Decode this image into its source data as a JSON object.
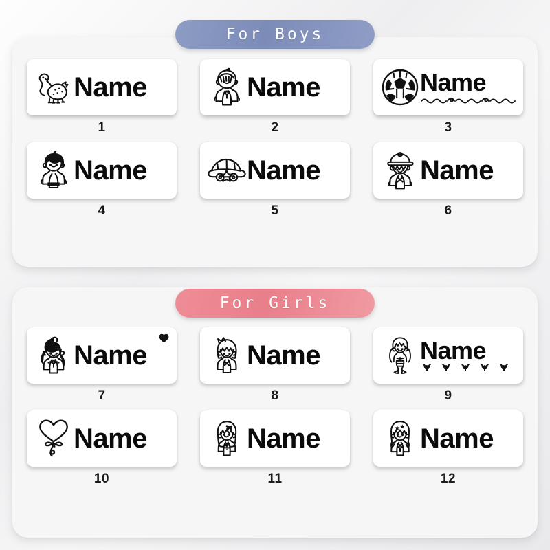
{
  "background": {
    "page_bg": "#f2f2f3",
    "panel_bg": "#f6f6f7"
  },
  "sections": [
    {
      "id": "boys",
      "banner_label": "For Boys",
      "banner_color": "#7c8cb8",
      "labels": [
        {
          "number": "1",
          "name": "Name",
          "icon": "dinosaur-icon",
          "decoration": "none"
        },
        {
          "number": "2",
          "name": "Name",
          "icon": "boy-outline-icon",
          "decoration": "none"
        },
        {
          "number": "3",
          "name": "Name",
          "icon": "soccer-ball-icon",
          "decoration": "wavy-line"
        },
        {
          "number": "4",
          "name": "Name",
          "icon": "boy-dark-hair-icon",
          "decoration": "none"
        },
        {
          "number": "5",
          "name": "Name",
          "icon": "car-icon",
          "decoration": "none"
        },
        {
          "number": "6",
          "name": "Name",
          "icon": "boy-cap-icon",
          "decoration": "none"
        }
      ]
    },
    {
      "id": "girls",
      "banner_label": "For Girls",
      "banner_color": "#e87f8b",
      "labels": [
        {
          "number": "7",
          "name": "Name",
          "icon": "girl-pigtails-icon",
          "decoration": "corner-heart"
        },
        {
          "number": "8",
          "name": "Name",
          "icon": "princess-crown-icon",
          "decoration": "none"
        },
        {
          "number": "9",
          "name": "Name",
          "icon": "mermaid-icon",
          "decoration": "seaweed-row"
        },
        {
          "number": "10",
          "name": "Name",
          "icon": "heart-balloon-icon",
          "decoration": "none"
        },
        {
          "number": "11",
          "name": "Name",
          "icon": "girl-longhair-bow-icon",
          "decoration": "none"
        },
        {
          "number": "12",
          "name": "Name",
          "icon": "girl-stars-icon",
          "decoration": "none"
        }
      ]
    }
  ]
}
